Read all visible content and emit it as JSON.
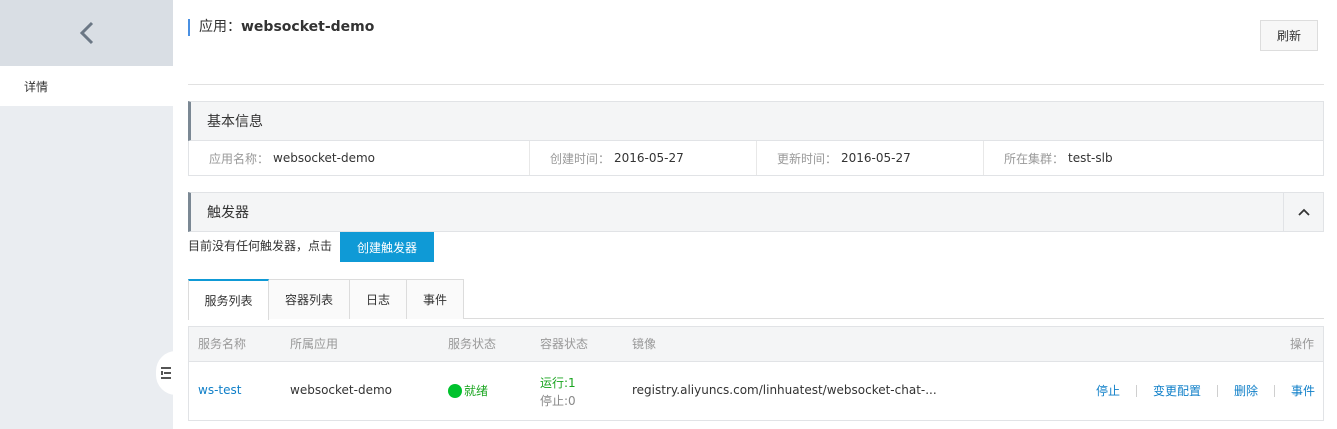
{
  "sidebar": {
    "nav_label": "详情"
  },
  "header": {
    "app_prefix": "应用：",
    "app_name": "websocket-demo",
    "refresh_label": "刷新"
  },
  "basic_info": {
    "title": "基本信息",
    "fields": [
      {
        "key": "应用名称：",
        "value": "websocket-demo"
      },
      {
        "key": "创建时间：",
        "value": "2016-05-27"
      },
      {
        "key": "更新时间：",
        "value": "2016-05-27"
      },
      {
        "key": "所在集群：",
        "value": "test-slb"
      }
    ]
  },
  "triggers": {
    "title": "触发器",
    "empty_text": "目前没有任何触发器，点击",
    "create_label": "创建触发器"
  },
  "tabs": [
    {
      "label": "服务列表"
    },
    {
      "label": "容器列表"
    },
    {
      "label": "日志"
    },
    {
      "label": "事件"
    }
  ],
  "table": {
    "headers": [
      "服务名称",
      "所属应用",
      "服务状态",
      "容器状态",
      "镜像",
      "操作"
    ],
    "rows": [
      {
        "name": "ws-test",
        "app": "websocket-demo",
        "status": "就绪",
        "container_running": "运行:1",
        "container_stopped": "停止:0",
        "image": "registry.aliyuncs.com/linhuatest/websocket-chat-...",
        "ops": [
          "停止",
          "变更配置",
          "删除",
          "事件"
        ]
      }
    ]
  },
  "colors": {
    "accent": "#0f9ad6",
    "link": "#0f7fc8",
    "status_ok": "#00c22d"
  }
}
